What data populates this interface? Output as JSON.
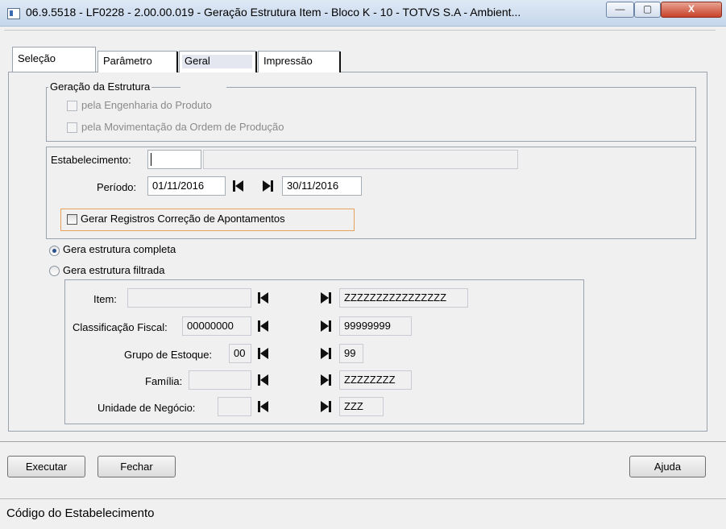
{
  "window": {
    "title": "06.9.5518 - LF0228 - 2.00.00.019 - Geração Estrutura Item - Bloco K - 10 - TOTVS S.A - Ambient...",
    "minimize": "—",
    "maximize": "▢",
    "close": "X"
  },
  "tabs": [
    {
      "label": "Seleção"
    },
    {
      "label": "Parâmetro"
    },
    {
      "label": "Geral"
    },
    {
      "label": "Impressão"
    }
  ],
  "geracao": {
    "legend": "Geração da Estrutura",
    "opt_engenharia": "pela Engenharia do Produto",
    "opt_movimentacao": "pela Movimentação da Ordem de Produção"
  },
  "estab": {
    "label": "Estabelecimento:",
    "code": "",
    "description": "",
    "periodo_label": "Período:",
    "periodo_ini": "01/11/2016",
    "periodo_fim": "30/11/2016",
    "gerar_registros": "Gerar Registros Correção de Apontamentos"
  },
  "estrutura": {
    "completa": "Gera estrutura completa",
    "filtrada": "Gera estrutura filtrada"
  },
  "filters": {
    "item": {
      "label": "Item:",
      "from": "",
      "to": "ZZZZZZZZZZZZZZZZ"
    },
    "classif": {
      "label": "Classificação Fiscal:",
      "from": "00000000",
      "to": "99999999"
    },
    "grupo": {
      "label": "Grupo de Estoque:",
      "from": "00",
      "to": "99"
    },
    "familia": {
      "label": "Família:",
      "from": "",
      "to": "ZZZZZZZZ"
    },
    "unidade": {
      "label": "Unidade de Negócio:",
      "from": "",
      "to": "ZZZ"
    }
  },
  "buttons": {
    "executar": "Executar",
    "fechar": "Fechar",
    "ajuda": "Ajuda"
  },
  "status": {
    "text": "Código do Estabelecimento"
  },
  "colors": {
    "highlight_border": "#e8a15a",
    "window_bg": "#f0f0f0"
  }
}
